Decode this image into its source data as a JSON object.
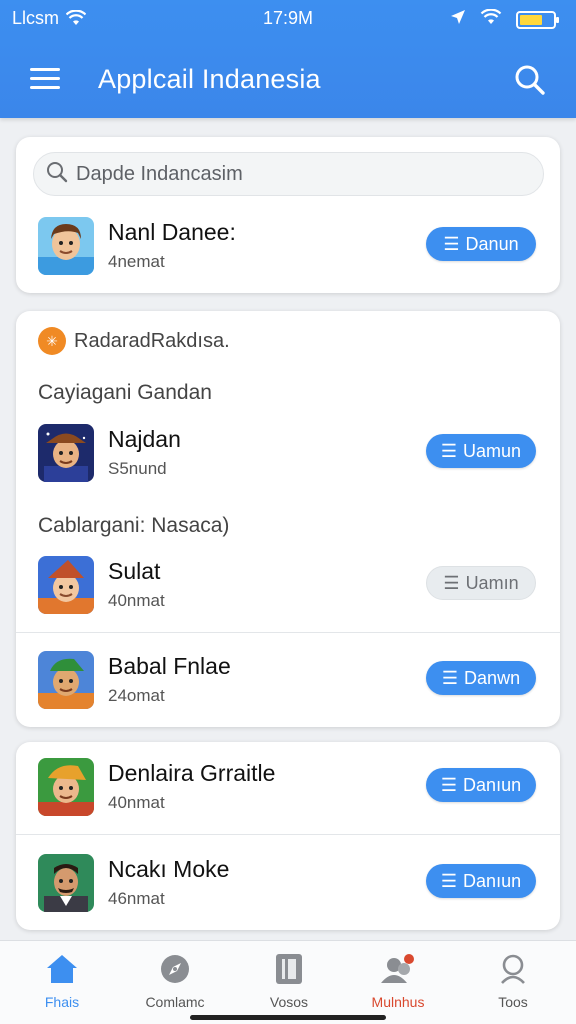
{
  "status_bar": {
    "carrier": "Llcsm",
    "time": "17:9M"
  },
  "header": {
    "title": "Applcail Indanesia"
  },
  "search": {
    "placeholder": "Dapde Indancasim"
  },
  "featured": {
    "name": "Nanl Danee:",
    "sub": "4nemat",
    "button": "Danun"
  },
  "section": {
    "badge": "RadaradRakdısa.",
    "group1_label": "Cayiagani Gandan",
    "group2_label": "Cablargani: Nasaca)"
  },
  "apps": [
    {
      "name": "Najdan",
      "sub": "S5nund",
      "button": "Uamun",
      "disabled": false
    },
    {
      "name": "Sulat",
      "sub": "40nmat",
      "button": "Uamın",
      "disabled": true
    },
    {
      "name": "Babal Fnlae",
      "sub": "24omat",
      "button": "Danwn",
      "disabled": false
    },
    {
      "name": "Denlaira Grraitle",
      "sub": "40nmat",
      "button": "Danıun",
      "disabled": false
    },
    {
      "name": "Ncakı Moke",
      "sub": "46nmat",
      "button": "Danıun",
      "disabled": false
    }
  ],
  "nav": [
    {
      "label": "Fhais",
      "icon": "home-icon",
      "state": "active"
    },
    {
      "label": "Comlamc",
      "icon": "compass-icon",
      "state": "normal"
    },
    {
      "label": "Vosos",
      "icon": "book-icon",
      "state": "normal"
    },
    {
      "label": "Mulnhus",
      "icon": "users-icon",
      "state": "alert"
    },
    {
      "label": "Toos",
      "icon": "profile-search-icon",
      "state": "normal"
    }
  ],
  "colors": {
    "accent": "#3d8ff0",
    "alert": "#d9492f",
    "badge": "#f08a24"
  }
}
